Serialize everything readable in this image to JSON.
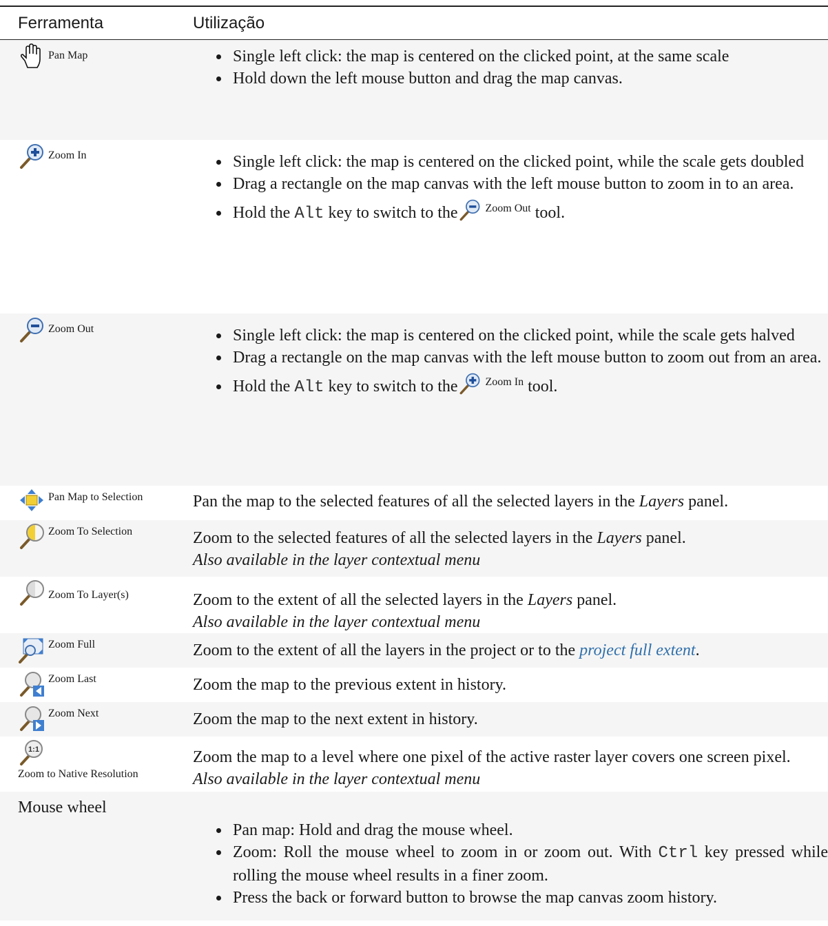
{
  "header": {
    "col1": "Ferramenta",
    "col2": "Utilização"
  },
  "rows": [
    {
      "tool": "Pan Map",
      "icon": "pan-hand-icon",
      "bullets": [
        "Single left click: the map is centered on the clicked point, at the same scale",
        "Hold down the left mouse button and drag the map canvas."
      ]
    },
    {
      "tool": "Zoom In",
      "icon": "zoom-in-icon",
      "bullets": [
        "Single left click: the map is centered on the clicked point, while the scale gets doubled",
        "Drag a rectangle on the map canvas with the left mouse button to zoom in to an area."
      ],
      "hold": {
        "pre": "Hold the",
        "key": "Alt",
        "mid": "key to switch to the",
        "tool": "Zoom Out",
        "post": "tool."
      }
    },
    {
      "tool": "Zoom Out",
      "icon": "zoom-out-icon",
      "bullets": [
        "Single left click: the map is centered on the clicked point, while the scale gets halved",
        "Drag a rectangle on the map canvas with the left mouse button to zoom out from an area."
      ],
      "hold": {
        "pre": "Hold the",
        "key": "Alt",
        "mid": "key to switch to the",
        "tool": "Zoom In",
        "post": "tool."
      }
    },
    {
      "tool": "Pan Map to Selection",
      "icon": "pan-to-selection-icon",
      "desc_pre": "Pan the map to the selected features of all the selected layers in the",
      "desc_em": "Layers",
      "desc_post": "panel."
    },
    {
      "tool": "Zoom To Selection",
      "icon": "zoom-to-selection-icon",
      "desc_pre": "Zoom to the selected features of all the selected layers in the",
      "desc_em": "Layers",
      "desc_post": "panel.",
      "note": "Also available in the layer contextual menu"
    },
    {
      "tool": "Zoom To Layer(s)",
      "icon": "zoom-to-layer-icon",
      "desc_pre": "Zoom to the extent of all the selected layers in the",
      "desc_em": "Layers",
      "desc_post": "panel.",
      "note": "Also available in the layer contextual menu"
    },
    {
      "tool": "Zoom Full",
      "icon": "zoom-full-icon",
      "desc_pre": "Zoom to the extent of all the layers in the project or to the",
      "link": "project full extent",
      "desc_post": "."
    },
    {
      "tool": "Zoom Last",
      "icon": "zoom-last-icon",
      "desc": "Zoom the map to the previous extent in history."
    },
    {
      "tool": "Zoom Next",
      "icon": "zoom-next-icon",
      "desc": "Zoom the map to the next extent in history."
    },
    {
      "tool": "Zoom to Native Resolution",
      "icon": "zoom-native-resolution-icon",
      "icon_text": "1:1",
      "desc": "Zoom the map to a level where one pixel of the active raster layer covers one screen pixel.",
      "note": "Also available in the layer contextual menu"
    },
    {
      "tool": "Mouse wheel",
      "bullets": [
        "Pan map: Hold and drag the mouse wheel."
      ],
      "zoom_bullet": {
        "pre": "Zoom: Roll the mouse wheel to zoom in or zoom out. With",
        "key": "Ctrl",
        "post": "key pressed while rolling the mouse wheel results in a finer zoom."
      },
      "last_bullet": "Press the back or forward button to browse the map canvas zoom history."
    }
  ],
  "colors": {
    "link": "#2f6fab",
    "row_shade": "#f5f5f5",
    "header_rule": "#222222"
  }
}
